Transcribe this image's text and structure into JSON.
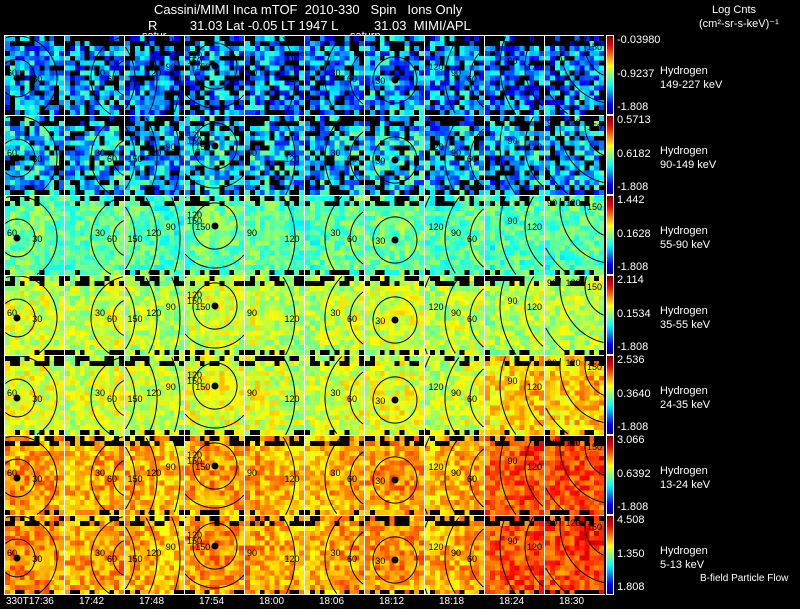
{
  "header": {
    "title_line1": "Cassini/MIMI Inca mTOF  2010-330   Spin   Ions Only",
    "title_line2": "R         31.03 Lat -0.05 LT 1947 L          31.03  MIMI/APL",
    "units_line1": "Log Cnts",
    "units_line2": "(cm²-sr-s-keV)⁻¹",
    "planet_labels": [
      "satur",
      "saturn"
    ]
  },
  "footer": {
    "legend": "B-field Particle Flow"
  },
  "chart_data": {
    "type": "heatmap",
    "title": "Cassini/MIMI Inca mTOF  2010-330   Spin   Ions Only",
    "x_tick_labels": [
      "330T17:36",
      "17:42",
      "17:48",
      "17:54",
      "18:00",
      "18:06",
      "18:12",
      "18:18",
      "18:24",
      "18:30"
    ],
    "colormap": "jet",
    "rows": [
      {
        "species": "Hydrogen",
        "energy": "149-227 keV",
        "cb_max": "-0.03980",
        "cb_mid": "-0.9237",
        "cb_min": "-1.808",
        "mean_level": 0.3
      },
      {
        "species": "Hydrogen",
        "energy": "90-149 keV",
        "cb_max": "0.5713",
        "cb_mid": "0.6182",
        "cb_min": "-1.808",
        "mean_level": 0.36
      },
      {
        "species": "Hydrogen",
        "energy": "55-90 keV",
        "cb_max": "1.442",
        "cb_mid": "0.1628",
        "cb_min": "-1.808",
        "mean_level": 0.5
      },
      {
        "species": "Hydrogen",
        "energy": "35-55 keV",
        "cb_max": "2.114",
        "cb_mid": "0.1534",
        "cb_min": "-1.808",
        "mean_level": 0.6
      },
      {
        "species": "Hydrogen",
        "energy": "24-35 keV",
        "cb_max": "2.536",
        "cb_mid": "0.3640",
        "cb_min": "-1.808",
        "mean_level": 0.62
      },
      {
        "species": "Hydrogen",
        "energy": "13-24 keV",
        "cb_max": "3.066",
        "cb_mid": "0.6392",
        "cb_min": "-1.808",
        "mean_level": 0.74
      },
      {
        "species": "Hydrogen",
        "energy": "5-13 keV",
        "cb_max": "4.508",
        "cb_mid": "1.350",
        "cb_min": "1.808",
        "mean_level": 0.75
      }
    ],
    "contour_labels_by_column": [
      [
        "30",
        "60"
      ],
      [
        "60",
        "30"
      ],
      [
        "150",
        "120",
        "90"
      ],
      [
        "150",
        "150",
        "120"
      ],
      [
        "120",
        "90"
      ],
      [
        "60",
        "30"
      ],
      [
        "30"
      ],
      [
        "60",
        "90",
        "120"
      ],
      [
        "120",
        "90"
      ],
      [
        "150",
        "120",
        "90"
      ]
    ]
  }
}
